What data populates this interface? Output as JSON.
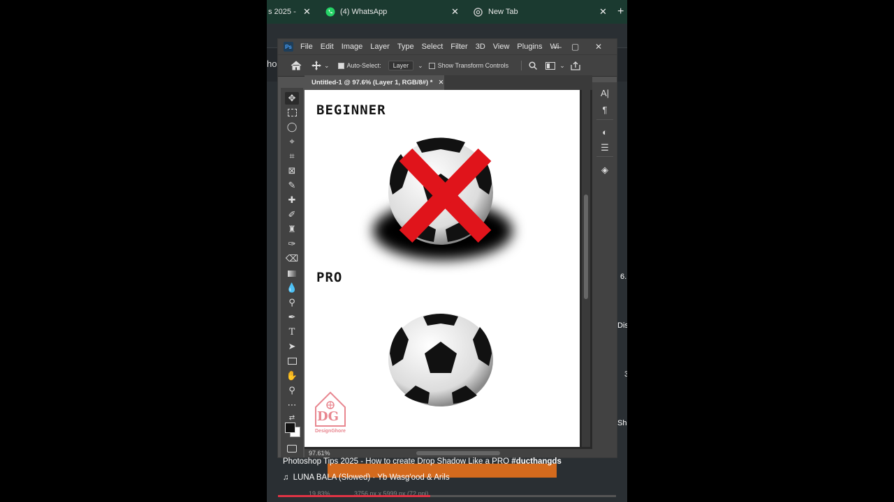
{
  "browser": {
    "tabs": [
      {
        "title": "s 2025 -",
        "close": "✕"
      },
      {
        "title": "(4) WhatsApp",
        "close": "✕"
      },
      {
        "title": "New Tab",
        "close": "✕"
      }
    ],
    "new_tab": "+"
  },
  "underlying_page": {
    "text": "ho"
  },
  "photoshop": {
    "logo": "Ps",
    "menu": [
      "File",
      "Edit",
      "Image",
      "Layer",
      "Type",
      "Select",
      "Filter",
      "3D",
      "View",
      "Plugins",
      "Wi"
    ],
    "window_controls": {
      "minimize": "—",
      "maximize": "▢",
      "close": "✕"
    },
    "options": {
      "auto_select_label": "Auto-Select:",
      "auto_select_value": "Layer",
      "transform_label": "Show Transform Controls"
    },
    "document_tab": "Untitled-1 @ 97.6% (Layer 1, RGB/8#) *",
    "document_tab_close": "✕",
    "canvas": {
      "heading_top": "BEGINNER",
      "heading_bottom": "PRO",
      "watermark_brand": "DesignGhore",
      "watermark_monogram": "DG"
    },
    "status_zoom": "97.61%"
  },
  "overlay": {
    "video_title_plain": "Photoshop Tips  2025 - How to create Drop Shadow Like a PRO ",
    "video_title_tag": "#ducthangds",
    "music": "LUNA BALA (Slowed) · Yb Wasg'ood & Arils",
    "progress_percent": 0.45,
    "status_zoom_bottom": "19.83%",
    "status_doc_bottom": "3756 px x 5999 px (72 ppi)",
    "side_labels": [
      "6.",
      "Dis",
      "3",
      "Sh"
    ]
  },
  "colors": {
    "tab_bar": "#1b3a30",
    "ps_panel": "#424242",
    "ps_bg": "#535353",
    "x_mark": "#e0141b",
    "watermark": "#e8868f",
    "progress": "#e03344"
  }
}
